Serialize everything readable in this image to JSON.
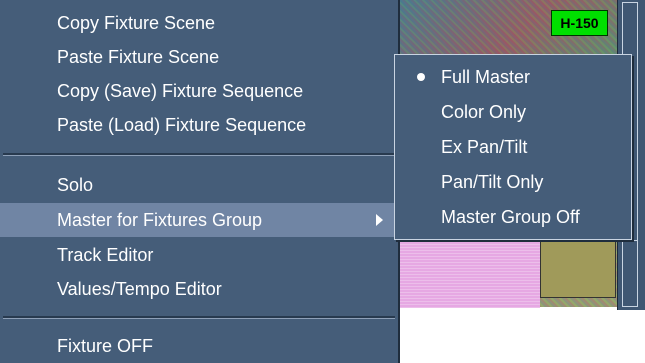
{
  "background": {
    "badge_label": "H-150"
  },
  "context_menu": {
    "items": [
      {
        "label": "Copy Fixture Scene"
      },
      {
        "label": "Paste Fixture Scene"
      },
      {
        "label": "Copy (Save) Fixture Sequence"
      },
      {
        "label": "Paste (Load) Fixture Sequence"
      },
      {
        "label": "Solo"
      },
      {
        "label": "Master for Fixtures Group",
        "highlighted": true,
        "has_submenu": true
      },
      {
        "label": "Track Editor"
      },
      {
        "label": "Values/Tempo Editor"
      },
      {
        "label": "Fixture OFF"
      }
    ]
  },
  "submenu": {
    "items": [
      {
        "label": "Full Master",
        "selected": true
      },
      {
        "label": "Color Only"
      },
      {
        "label": "Ex Pan/Tilt"
      },
      {
        "label": "Pan/Tilt Only"
      },
      {
        "label": "Master Group Off"
      }
    ]
  },
  "colors": {
    "menu_bg": "#455d79",
    "highlight_bg": "#7085a4",
    "text": "#ffffff",
    "badge_bg": "#00e000"
  }
}
